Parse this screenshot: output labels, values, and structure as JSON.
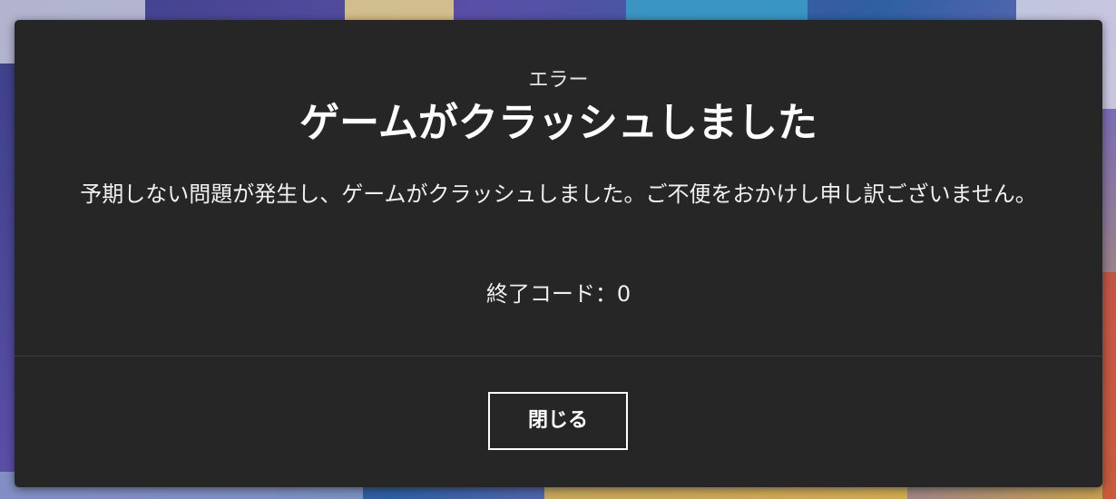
{
  "dialog": {
    "label": "エラー",
    "title": "ゲームがクラッシュしました",
    "message": "予期しない問題が発生し、ゲームがクラッシュしました。ご不便をおかけし申し訳ございません。",
    "exit_code": "終了コード：0",
    "close_label": "閉じる"
  },
  "colors": {
    "dialog_background": "#262626",
    "text": "#ffffff",
    "divider": "#3d3d3d"
  }
}
